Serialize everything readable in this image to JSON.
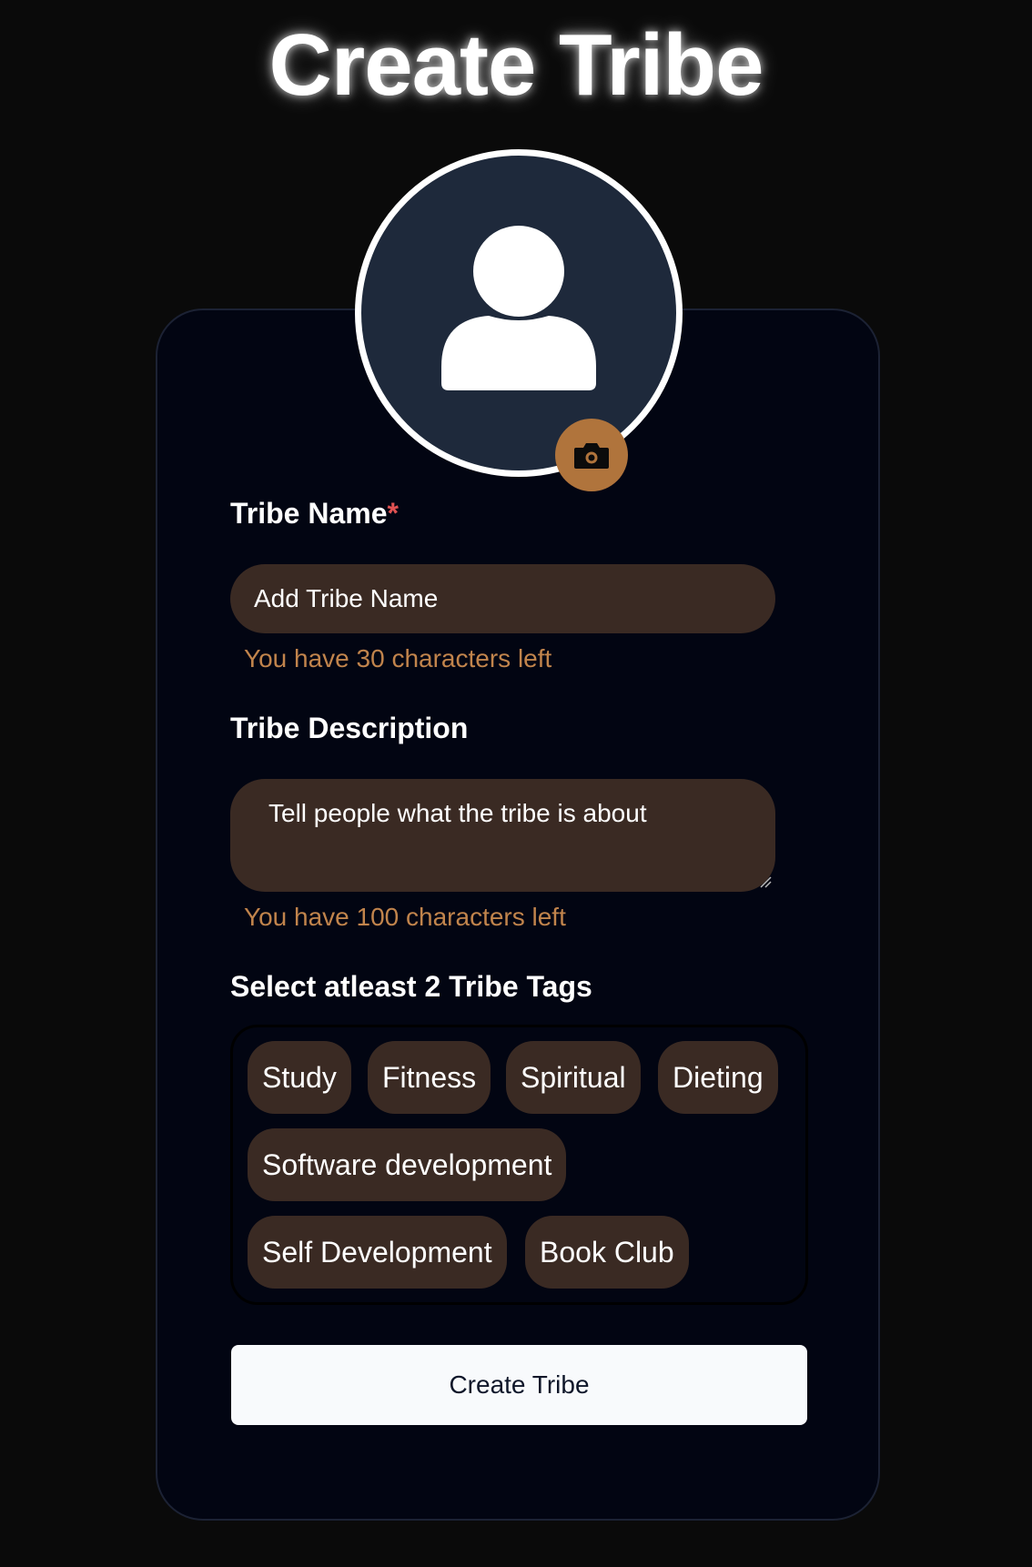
{
  "page": {
    "title": "Create Tribe"
  },
  "avatar": {
    "icon": "user-silhouette-icon",
    "upload_icon": "camera-icon"
  },
  "form": {
    "name_label": "Tribe Name",
    "name_required_mark": "*",
    "name_placeholder": "Add Tribe Name",
    "name_value": "",
    "name_helper": "You have 30 characters left",
    "description_label": "Tribe Description",
    "description_placeholder": "Tell people what the tribe is about",
    "description_value": "",
    "description_helper": "You have 100 characters left",
    "tags_label": "Select atleast 2 Tribe Tags",
    "tags": [
      "Study",
      "Fitness",
      "Spiritual",
      "Dieting",
      "Software development",
      "Self Development",
      "Book Club"
    ],
    "submit_label": "Create Tribe"
  },
  "colors": {
    "background": "#0a0a0a",
    "card": "#020512",
    "avatar_bg": "#1e293b",
    "input_bg": "#3a2a23",
    "accent": "#b0743c",
    "helper_text": "#c1844c",
    "required": "#e05252",
    "button_bg": "#f8fafc",
    "button_text": "#0f172a"
  }
}
